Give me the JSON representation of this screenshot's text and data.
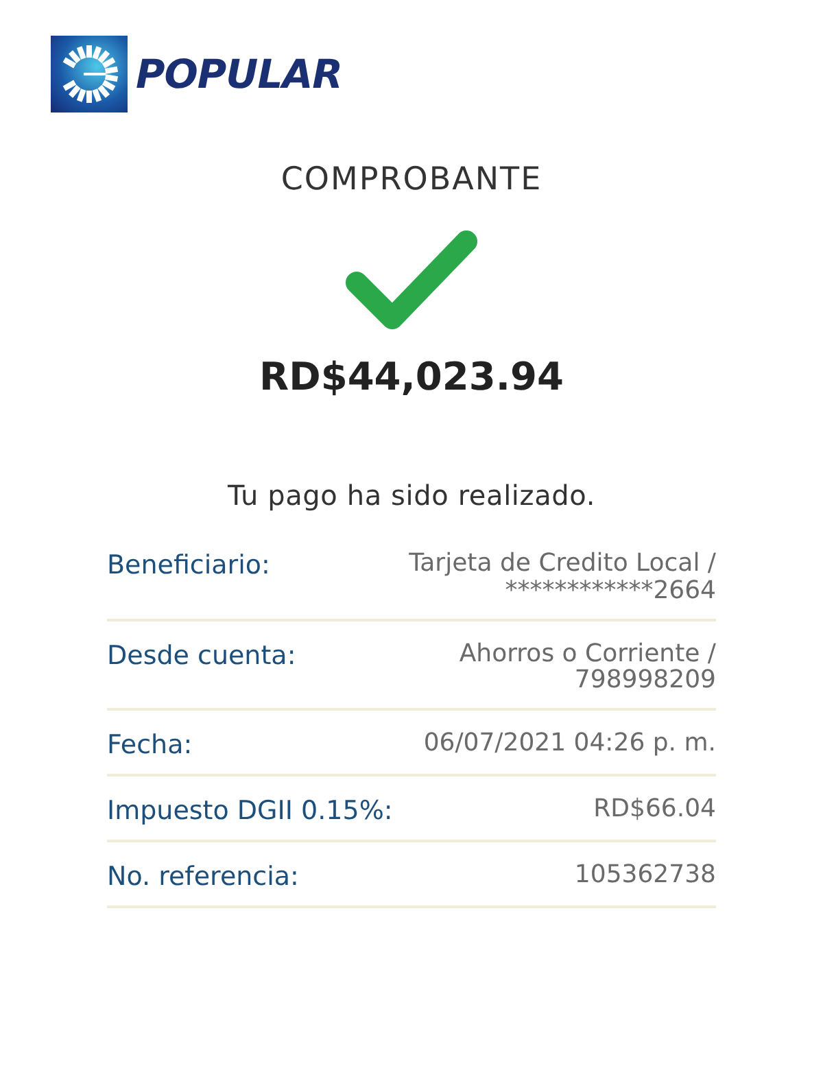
{
  "header": {
    "brand": "POPULAR"
  },
  "title": "COMPROBANTE",
  "status": {
    "kind": "success"
  },
  "amount": "RD$44,023.94",
  "message": "Tu pago ha sido realizado.",
  "details": [
    {
      "label": "Beneficiario:",
      "value": "Tarjeta de Credito Local / ************2664"
    },
    {
      "label": "Desde cuenta:",
      "value": "Ahorros o Corriente / 798998209"
    },
    {
      "label": "Fecha:",
      "value": "06/07/2021 04:26 p. m."
    },
    {
      "label": "Impuesto DGII 0.15%:",
      "value": "RD$66.04"
    },
    {
      "label": "No. referencia:",
      "value": "105362738"
    }
  ]
}
